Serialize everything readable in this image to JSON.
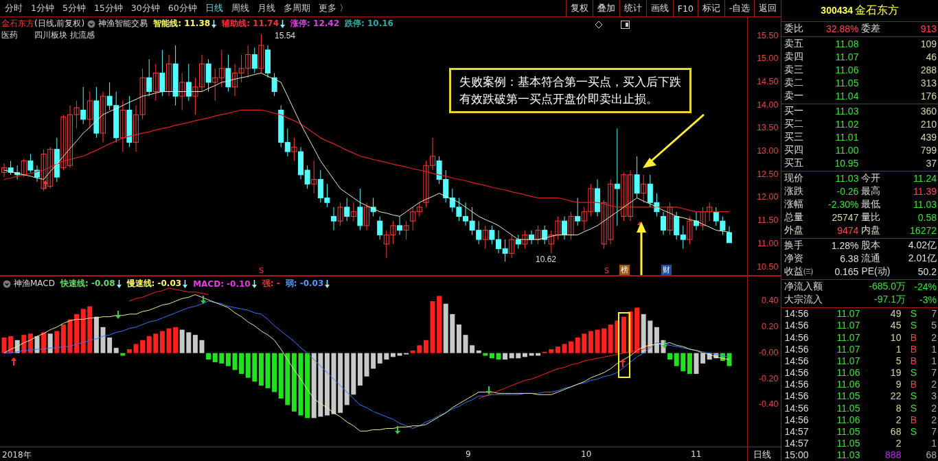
{
  "periods": [
    {
      "label": "分时",
      "selected": false
    },
    {
      "label": "1分钟",
      "selected": false
    },
    {
      "label": "5分钟",
      "selected": false
    },
    {
      "label": "15分钟",
      "selected": false
    },
    {
      "label": "30分钟",
      "selected": false
    },
    {
      "label": "60分钟",
      "selected": false
    },
    {
      "label": "日线",
      "selected": true
    },
    {
      "label": "周线",
      "selected": false
    },
    {
      "label": "月线",
      "selected": false
    },
    {
      "label": "多周期",
      "selected": false
    },
    {
      "label": "更多 〉",
      "selected": false
    }
  ],
  "tools": [
    "复权",
    "叠加",
    "统计",
    "画线",
    "F10",
    "标记",
    "-自选",
    "返回"
  ],
  "chart_info": {
    "stock": "金石东方",
    "mode": "(日线,前复权)",
    "indicator": "神渔智能交易",
    "lines": [
      {
        "label": "智能线: 11.38",
        "color": "#ffff66",
        "arrow": true
      },
      {
        "label": "辅助线: 11.74",
        "color": "#ff3030",
        "arrow": true
      },
      {
        "label": "涨停: 12.42",
        "color": "#e040e0",
        "arrow": false
      },
      {
        "label": "跌停: 10.16",
        "color": "#33aaaa",
        "arrow": false
      }
    ],
    "tags": [
      "医药",
      "四川板块",
      "抗流感"
    ]
  },
  "chart_data": {
    "type": "candlestick",
    "ylim": [
      10.33,
      15.91
    ],
    "ohlc": [
      [
        12.55,
        12.75,
        12.45,
        12.65
      ],
      [
        12.65,
        12.8,
        12.5,
        12.55
      ],
      [
        12.55,
        12.7,
        12.4,
        12.5
      ],
      [
        12.5,
        12.85,
        12.45,
        12.8
      ],
      [
        12.8,
        12.95,
        12.55,
        12.6
      ],
      [
        12.6,
        12.7,
        12.35,
        12.45
      ],
      [
        12.2,
        13.05,
        12.15,
        12.95
      ],
      [
        12.25,
        13.1,
        12.2,
        13.05
      ],
      [
        13.05,
        13.3,
        12.35,
        12.45
      ],
      [
        12.65,
        13.8,
        12.6,
        13.75
      ],
      [
        12.7,
        14.0,
        12.65,
        13.8
      ],
      [
        13.8,
        14.1,
        13.5,
        13.95
      ],
      [
        13.9,
        14.4,
        13.6,
        13.7
      ],
      [
        13.7,
        14.3,
        13.5,
        14.1
      ],
      [
        14.1,
        14.4,
        13.3,
        13.4
      ],
      [
        13.4,
        14.3,
        13.2,
        14.2
      ],
      [
        14.2,
        14.5,
        13.9,
        14.0
      ],
      [
        14.0,
        14.3,
        13.2,
        13.3
      ],
      [
        13.3,
        14.1,
        13.0,
        13.9
      ],
      [
        13.9,
        14.2,
        13.1,
        13.2
      ],
      [
        13.2,
        14.0,
        13.0,
        13.8
      ],
      [
        13.8,
        14.8,
        13.7,
        14.6
      ],
      [
        14.6,
        15.0,
        14.2,
        14.3
      ],
      [
        14.3,
        14.9,
        14.1,
        14.7
      ],
      [
        14.7,
        15.2,
        14.2,
        14.3
      ],
      [
        14.3,
        15.1,
        14.2,
        14.9
      ],
      [
        14.9,
        15.3,
        14.0,
        14.2
      ],
      [
        14.2,
        14.7,
        13.9,
        14.5
      ],
      [
        14.5,
        14.9,
        14.1,
        14.2
      ],
      [
        14.2,
        14.6,
        13.8,
        14.4
      ],
      [
        14.4,
        15.1,
        14.3,
        14.9
      ],
      [
        14.9,
        15.0,
        14.3,
        14.5
      ],
      [
        14.5,
        14.8,
        14.1,
        14.6
      ],
      [
        14.6,
        15.2,
        14.4,
        14.8
      ],
      [
        14.8,
        15.1,
        14.3,
        14.4
      ],
      [
        14.4,
        14.9,
        14.2,
        14.7
      ],
      [
        14.7,
        15.1,
        14.5,
        14.8
      ],
      [
        14.8,
        15.3,
        14.6,
        15.1
      ],
      [
        15.1,
        15.25,
        14.7,
        14.8
      ],
      [
        14.8,
        15.54,
        14.7,
        15.3
      ],
      [
        15.2,
        15.3,
        14.6,
        14.7
      ],
      [
        14.6,
        14.7,
        14.2,
        14.3
      ],
      [
        13.9,
        14.0,
        13.1,
        13.2
      ],
      [
        13.2,
        13.5,
        12.9,
        13.0
      ],
      [
        13.0,
        13.3,
        12.8,
        13.1
      ],
      [
        13.0,
        13.1,
        12.4,
        12.5
      ],
      [
        12.6,
        12.7,
        12.2,
        12.3
      ],
      [
        12.3,
        12.8,
        12.1,
        12.4
      ],
      [
        12.4,
        12.6,
        11.9,
        12.0
      ],
      [
        12.0,
        12.3,
        11.8,
        11.9
      ],
      [
        11.6,
        11.8,
        11.3,
        11.5
      ],
      [
        11.5,
        11.9,
        11.4,
        11.8
      ],
      [
        11.8,
        12.0,
        11.5,
        11.6
      ],
      [
        11.6,
        11.9,
        11.5,
        11.7
      ],
      [
        11.8,
        12.2,
        11.3,
        11.4
      ],
      [
        11.4,
        11.9,
        11.3,
        11.8
      ],
      [
        11.8,
        12.0,
        11.6,
        11.7
      ],
      [
        11.5,
        11.6,
        11.1,
        11.2
      ],
      [
        11.0,
        11.3,
        10.7,
        11.2
      ],
      [
        11.2,
        11.5,
        11.0,
        11.4
      ],
      [
        11.4,
        11.6,
        11.2,
        11.3
      ],
      [
        11.3,
        11.5,
        11.1,
        11.4
      ],
      [
        11.5,
        11.8,
        11.3,
        11.7
      ],
      [
        11.7,
        11.9,
        11.6,
        11.8
      ],
      [
        11.9,
        12.8,
        11.8,
        12.7
      ],
      [
        12.7,
        13.3,
        12.6,
        12.9
      ],
      [
        12.8,
        12.9,
        12.3,
        12.4
      ],
      [
        12.4,
        12.6,
        11.9,
        12.0
      ],
      [
        12.0,
        12.2,
        11.7,
        11.8
      ],
      [
        11.8,
        12.0,
        11.5,
        11.6
      ],
      [
        11.6,
        11.9,
        11.4,
        11.5
      ],
      [
        11.5,
        11.8,
        11.2,
        11.3
      ],
      [
        11.3,
        11.5,
        11.0,
        11.1
      ],
      [
        11.1,
        11.4,
        10.9,
        11.3
      ],
      [
        11.3,
        11.4,
        11.0,
        11.1
      ],
      [
        11.1,
        11.3,
        10.8,
        10.9
      ],
      [
        10.9,
        11.1,
        10.62,
        10.8
      ],
      [
        10.8,
        11.2,
        10.7,
        11.1
      ],
      [
        11.1,
        11.2,
        10.9,
        11.0
      ],
      [
        11.0,
        11.3,
        10.9,
        11.2
      ],
      [
        11.2,
        11.3,
        11.0,
        11.1
      ],
      [
        11.1,
        11.4,
        11.0,
        11.3
      ],
      [
        11.3,
        11.4,
        11.0,
        11.1
      ],
      [
        11.0,
        11.3,
        10.8,
        11.2
      ],
      [
        11.2,
        11.6,
        11.1,
        11.5
      ],
      [
        11.5,
        11.6,
        11.1,
        11.2
      ],
      [
        11.2,
        11.7,
        11.1,
        11.6
      ],
      [
        11.6,
        12.0,
        11.4,
        11.5
      ],
      [
        11.5,
        11.8,
        11.3,
        11.7
      ],
      [
        11.7,
        12.3,
        11.6,
        12.2
      ],
      [
        12.2,
        12.4,
        11.6,
        11.7
      ],
      [
        11.0,
        11.95,
        10.9,
        11.9
      ],
      [
        11.1,
        12.4,
        11.0,
        12.3
      ],
      [
        12.3,
        13.5,
        11.4,
        12.2
      ],
      [
        11.6,
        12.55,
        11.5,
        12.5
      ],
      [
        11.6,
        12.6,
        11.5,
        12.5
      ],
      [
        12.5,
        12.9,
        12.0,
        12.1
      ],
      [
        12.1,
        12.5,
        11.9,
        12.3
      ],
      [
        12.3,
        12.5,
        11.8,
        11.9
      ],
      [
        11.9,
        12.1,
        11.6,
        11.7
      ],
      [
        11.6,
        11.7,
        11.2,
        11.3
      ],
      [
        11.3,
        11.9,
        11.2,
        11.8
      ],
      [
        11.6,
        11.7,
        11.1,
        11.2
      ],
      [
        11.2,
        11.4,
        10.9,
        11.1
      ],
      [
        11.1,
        11.6,
        11.0,
        11.5
      ],
      [
        11.5,
        11.7,
        11.3,
        11.4
      ],
      [
        11.4,
        11.8,
        11.3,
        11.7
      ],
      [
        11.7,
        11.9,
        11.5,
        11.8
      ],
      [
        11.7,
        11.8,
        11.4,
        11.5
      ],
      [
        11.5,
        11.6,
        11.2,
        11.3
      ],
      [
        11.25,
        11.39,
        11.03,
        11.03
      ]
    ],
    "yticks": [
      {
        "value": 15.5,
        "label": "15.50"
      },
      {
        "value": 15.0,
        "label": "15.00"
      },
      {
        "value": 14.5,
        "label": "14.50"
      },
      {
        "value": 14.0,
        "label": "14.00"
      },
      {
        "value": 13.5,
        "label": "13.50"
      },
      {
        "value": 13.0,
        "label": "13.00"
      },
      {
        "value": 12.5,
        "label": "12.50"
      },
      {
        "value": 12.0,
        "label": "12.00"
      },
      {
        "value": 11.5,
        "label": "11.50"
      },
      {
        "value": 11.0,
        "label": "11.00"
      },
      {
        "value": 10.5,
        "label": "10.50"
      }
    ],
    "series": [
      {
        "type": "line",
        "color": "#e02020",
        "values": [
          12.4,
          12.43,
          12.47,
          12.5,
          12.53,
          12.57,
          12.6,
          12.67,
          12.73,
          12.8,
          12.83,
          12.87,
          12.9,
          12.97,
          13.03,
          13.1,
          13.17,
          13.23,
          13.3,
          13.33,
          13.37,
          13.4,
          13.43,
          13.47,
          13.5,
          13.53,
          13.57,
          13.6,
          13.63,
          13.67,
          13.7,
          13.73,
          13.77,
          13.8,
          13.83,
          13.87,
          13.9,
          13.9,
          13.9,
          13.9,
          13.87,
          13.83,
          13.8,
          13.73,
          13.67,
          13.6,
          13.5,
          13.4,
          13.3,
          13.23,
          13.17,
          13.1,
          13.03,
          12.97,
          12.9,
          12.87,
          12.83,
          12.8,
          12.77,
          12.73,
          12.7,
          12.67,
          12.63,
          12.6,
          12.57,
          12.53,
          12.5,
          12.47,
          12.43,
          12.4,
          12.37,
          12.33,
          12.3,
          12.27,
          12.23,
          12.2,
          12.17,
          12.13,
          12.1,
          12.07,
          12.03,
          12.0,
          12.0,
          12.0,
          12.0,
          11.97,
          11.93,
          11.9,
          11.9,
          11.9,
          11.9,
          11.87,
          11.83,
          11.8,
          11.8,
          11.8,
          11.8,
          11.8,
          11.8,
          11.8,
          11.8,
          11.8,
          11.8,
          11.77,
          11.73,
          11.7,
          11.7,
          11.7,
          11.7,
          11.7,
          11.7
        ]
      },
      {
        "type": "line",
        "color": "#f0f0c0",
        "values": [
          12.6,
          12.57,
          12.53,
          12.5,
          12.47,
          12.43,
          12.4,
          12.57,
          12.73,
          12.9,
          13.07,
          13.23,
          13.4,
          13.53,
          13.67,
          13.8,
          13.87,
          13.93,
          14.0,
          14.07,
          14.13,
          14.2,
          14.23,
          14.27,
          14.3,
          14.3,
          14.3,
          14.3,
          14.3,
          14.3,
          14.3,
          14.37,
          14.43,
          14.5,
          14.53,
          14.57,
          14.6,
          14.63,
          14.67,
          14.7,
          14.63,
          14.57,
          14.5,
          14.2,
          13.9,
          13.6,
          13.33,
          13.07,
          12.8,
          12.6,
          12.4,
          12.2,
          12.1,
          12.0,
          11.9,
          11.83,
          11.77,
          11.7,
          11.67,
          11.63,
          11.6,
          11.7,
          11.8,
          11.9,
          11.97,
          12.03,
          12.1,
          12.03,
          11.97,
          11.9,
          11.8,
          11.7,
          11.6,
          11.53,
          11.47,
          11.4,
          11.3,
          11.2,
          11.1,
          11.1,
          11.1,
          11.1,
          11.13,
          11.17,
          11.2,
          11.2,
          11.2,
          11.2,
          11.27,
          11.33,
          11.4,
          11.5,
          11.6,
          11.7,
          11.8,
          11.9,
          12.0,
          11.93,
          11.87,
          11.8,
          11.73,
          11.67,
          11.6,
          11.57,
          11.53,
          11.5,
          11.43,
          11.37,
          11.3,
          11.28,
          11.26
        ]
      }
    ]
  },
  "price_labels": {
    "high": "15.54",
    "low": "10.62"
  },
  "markers": [
    {
      "kind": "sell",
      "text": "S"
    },
    {
      "kind": "sell",
      "text": "S"
    },
    {
      "kind": "rank",
      "text": "榜"
    },
    {
      "kind": "finance",
      "text": "财"
    }
  ],
  "annotation": {
    "lines": [
      "失败案例：基本符合第一买点，买入后下跌",
      "有效跌破第一买点开盘价即卖出止损。"
    ]
  },
  "macd_info": {
    "name": "神渔MACD",
    "lines": [
      {
        "label": "快速线: -0.08",
        "color": "#66dd66",
        "arrow": true
      },
      {
        "label": "慢速线: -0.03",
        "color": "#ffff66",
        "arrow": true
      },
      {
        "label": "MACD: -0.10",
        "color": "#e040e0",
        "arrow": true
      },
      {
        "label": "强: -",
        "color": "#ff3030",
        "arrow": false
      },
      {
        "label": "弱: -0.03",
        "color": "#5599ff",
        "arrow": true
      }
    ]
  },
  "macd_chart": {
    "chart_data": {
      "type": "bar",
      "ylim": [
        -0.72,
        0.59
      ],
      "yticks": [
        {
          "value": 0.4,
          "label": "0.40"
        },
        {
          "value": 0.2,
          "label": "0.20"
        },
        {
          "value": 0,
          "label": "-0.00"
        },
        {
          "value": -0.2,
          "label": "-0.20"
        },
        {
          "value": -0.4,
          "label": "-0.40"
        }
      ],
      "series": [
        {
          "type": "bar",
          "colors": [
            "#ff2020",
            "#ff2020",
            "#c8c8c8",
            "#ff2020",
            "#ff2020",
            "#c8c8c8",
            "#ff2020",
            "#c8c8c8",
            "#ff2020",
            "#ff2020",
            "#ff2020",
            "#ff2020",
            "#ff2020",
            "#ff2020",
            "#c8c8c8",
            "#c8c8c8",
            "#c8c8c8",
            "#c8c8c8",
            "#22e022",
            "#ff2020",
            "#ff2020",
            "#ff2020",
            "#ff2020",
            "#ff2020",
            "#ff2020",
            "#ff2020",
            "#ff2020",
            "#c8c8c8",
            "#c8c8c8",
            "#c8c8c8",
            "#c8c8c8",
            "#22e022",
            "#22e022",
            "#22e022",
            "#22e022",
            "#22e022",
            "#22e022",
            "#22e022",
            "#22e022",
            "#22e022",
            "#22e022",
            "#22e022",
            "#22e022",
            "#22e022",
            "#22e022",
            "#22e022",
            "#22e022",
            "#c8c8c8",
            "#c8c8c8",
            "#c8c8c8",
            "#c8c8c8",
            "#c8c8c8",
            "#c8c8c8",
            "#c8c8c8",
            "#c8c8c8",
            "#c8c8c8",
            "#c8c8c8",
            "#c8c8c8",
            "#c8c8c8",
            "#c8c8c8",
            "#c8c8c8",
            "#c8c8c8",
            "#ff2020",
            "#ff2020",
            "#ff2020",
            "#ff2020",
            "#ff2020",
            "#c8c8c8",
            "#c8c8c8",
            "#c8c8c8",
            "#c8c8c8",
            "#c8c8c8",
            "#c8c8c8",
            "#22e022",
            "#22e022",
            "#22e022",
            "#c8c8c8",
            "#c8c8c8",
            "#c8c8c8",
            "#c8c8c8",
            "#c8c8c8",
            "#c8c8c8",
            "#ff2020",
            "#ff2020",
            "#ff2020",
            "#ff2020",
            "#ff2020",
            "#ff2020",
            "#ff2020",
            "#ff2020",
            "#ff2020",
            "#ff2020",
            "#ff2020",
            "#ff2020",
            "#ff2020",
            "#ff2020",
            "#ff2020",
            "#c8c8c8",
            "#c8c8c8",
            "#c8c8c8",
            "#c8c8c8",
            "#22e022",
            "#22e022",
            "#22e022",
            "#22e022",
            "#c8c8c8",
            "#c8c8c8",
            "#c8c8c8",
            "#c8c8c8",
            "#22e022",
            "#22e022"
          ],
          "values": [
            0.12,
            0.13,
            0.1,
            0.14,
            0.15,
            0.13,
            0.16,
            0.15,
            0.17,
            0.22,
            0.26,
            0.3,
            0.34,
            0.36,
            0.28,
            0.2,
            0.12,
            0.04,
            -0.02,
            0.03,
            0.07,
            0.1,
            0.13,
            0.15,
            0.17,
            0.19,
            0.2,
            0.18,
            0.16,
            0.14,
            0.1,
            -0.05,
            -0.07,
            -0.08,
            -0.1,
            -0.13,
            -0.16,
            -0.19,
            -0.22,
            -0.25,
            -0.27,
            -0.3,
            -0.35,
            -0.4,
            -0.45,
            -0.48,
            -0.5,
            -0.5,
            -0.49,
            -0.48,
            -0.47,
            -0.46,
            -0.4,
            -0.32,
            -0.25,
            -0.18,
            -0.12,
            -0.08,
            -0.05,
            -0.03,
            -0.02,
            -0.01,
            0.02,
            0.06,
            0.1,
            0.4,
            0.44,
            0.38,
            0.3,
            0.22,
            0.14,
            0.06,
            0.02,
            -0.02,
            -0.04,
            -0.05,
            -0.05,
            -0.04,
            -0.04,
            -0.03,
            -0.02,
            -0.02,
            0.01,
            0.03,
            0.05,
            0.07,
            0.09,
            0.12,
            0.15,
            0.17,
            0.18,
            0.19,
            0.22,
            0.25,
            0.28,
            0.32,
            0.35,
            0.3,
            0.25,
            0.2,
            0.1,
            -0.05,
            -0.1,
            -0.14,
            -0.16,
            -0.16,
            -0.08,
            -0.05,
            -0.04,
            -0.06,
            -0.1
          ]
        },
        {
          "type": "line",
          "color": "#3377ff",
          "values": [
            0,
            0,
            0.01,
            0.02,
            0.02,
            0.03,
            0.03,
            0.04,
            0.04,
            0.05,
            0.05,
            0.07,
            0.08,
            0.1,
            0.11,
            0.13,
            0.14,
            0.16,
            0.17,
            0.19,
            0.2,
            0.22,
            0.24,
            0.25,
            0.27,
            0.29,
            0.31,
            0.33,
            0.35,
            0.36,
            0.38,
            0.4,
            0.39,
            0.38,
            0.36,
            0.35,
            0.34,
            0.33,
            0.31,
            0.3,
            0.26,
            0.21,
            0.17,
            0.13,
            0.09,
            0.04,
            0,
            -0.05,
            -0.1,
            -0.15,
            -0.2,
            -0.25,
            -0.3,
            -0.35,
            -0.4,
            -0.42,
            -0.45,
            -0.47,
            -0.49,
            -0.51,
            -0.54,
            -0.56,
            -0.58,
            -0.56,
            -0.53,
            -0.51,
            -0.48,
            -0.46,
            -0.43,
            -0.41,
            -0.38,
            -0.36,
            -0.33,
            -0.33,
            -0.32,
            -0.32,
            -0.32,
            -0.32,
            -0.32,
            -0.31,
            -0.31,
            -0.31,
            -0.3,
            -0.3,
            -0.29,
            -0.27,
            -0.26,
            -0.24,
            -0.23,
            -0.21,
            -0.2,
            -0.18,
            -0.17,
            -0.15,
            -0.11,
            -0.07,
            -0.03,
            0,
            0.04,
            0.08,
            0.07,
            0.06,
            0.05,
            0.04,
            0.03,
            0.02,
            0.01,
            0,
            -0.01,
            -0.02,
            -0.03
          ]
        },
        {
          "type": "line",
          "color": "#eeee99",
          "values": [
            0,
            0.03,
            0.05,
            0.08,
            0.1,
            0.13,
            0.15,
            0.18,
            0.2,
            0.23,
            0.25,
            0.26,
            0.26,
            0.27,
            0.27,
            0.28,
            0.28,
            0.29,
            0.29,
            0.3,
            0.3,
            0.32,
            0.33,
            0.35,
            0.37,
            0.38,
            0.4,
            0.42,
            0.43,
            0.45,
            0.43,
            0.41,
            0.39,
            0.37,
            0.35,
            0.31,
            0.28,
            0.24,
            0.21,
            0.17,
            0.14,
            0.1,
            0.03,
            -0.05,
            -0.13,
            -0.2,
            -0.28,
            -0.35,
            -0.39,
            -0.42,
            -0.46,
            -0.49,
            -0.53,
            -0.56,
            -0.6,
            -0.6,
            -0.59,
            -0.59,
            -0.58,
            -0.58,
            -0.57,
            -0.57,
            -0.56,
            -0.56,
            -0.55,
            -0.52,
            -0.49,
            -0.46,
            -0.42,
            -0.39,
            -0.36,
            -0.33,
            -0.3,
            -0.3,
            -0.3,
            -0.31,
            -0.31,
            -0.31,
            -0.31,
            -0.31,
            -0.31,
            -0.32,
            -0.32,
            -0.32,
            -0.3,
            -0.28,
            -0.26,
            -0.24,
            -0.22,
            -0.19,
            -0.17,
            -0.15,
            -0.12,
            -0.08,
            -0.05,
            -0.02,
            0.02,
            0.05,
            0.06,
            0.07,
            0.07,
            0.08,
            0.06,
            0.05,
            0.03,
            0.02,
            0,
            -0.01,
            -0.03,
            -0.04,
            -0.05
          ]
        },
        {
          "type": "line",
          "color": "#ff2020",
          "values": [
            null,
            null,
            null,
            null,
            null,
            null,
            null,
            null,
            null,
            null,
            null,
            null,
            null,
            null,
            null,
            null,
            null,
            null,
            null,
            0.4,
            0.42,
            0.43,
            0.45,
            0.47,
            0.48,
            0.5,
            0.49,
            0.48,
            0.47,
            0.47,
            0.46,
            0.45,
            null,
            null,
            null,
            null,
            null,
            null,
            null,
            null,
            null,
            null,
            null,
            null,
            null,
            null,
            null,
            null,
            null,
            null,
            null,
            null,
            null,
            null,
            null,
            null,
            null,
            null,
            null,
            null,
            null,
            null,
            null,
            null,
            null,
            null,
            null,
            null,
            null,
            null,
            null,
            null,
            -0.35,
            -0.33,
            -0.31,
            -0.29,
            -0.27,
            -0.25,
            -0.23,
            -0.21,
            -0.2,
            -0.18,
            -0.16,
            -0.14,
            -0.12,
            -0.11,
            -0.09,
            -0.08,
            -0.06,
            -0.05,
            -0.04,
            -0.03,
            -0.02,
            -0.01,
            0,
            0.01,
            0.02,
            0.03,
            0.05,
            null,
            null,
            null,
            null,
            null,
            null,
            null,
            null,
            null,
            null,
            null,
            null
          ]
        }
      ]
    }
  },
  "time_axis": [
    "2018年",
    "9",
    "10",
    "11"
  ],
  "period_label": "日线",
  "quote": {
    "code": "300434",
    "name": "金石东方",
    "ratio": {
      "left": {
        "label": "委比",
        "value": "32.88%",
        "color": "#ff4a4a"
      },
      "right": {
        "label": "委差",
        "value": "913",
        "color": "#ff4a4a"
      }
    },
    "asks": [
      {
        "label": "卖五",
        "price": "11.08",
        "volume": "109"
      },
      {
        "label": "卖四",
        "price": "11.07",
        "volume": "46"
      },
      {
        "label": "卖三",
        "price": "11.06",
        "volume": "288"
      },
      {
        "label": "卖二",
        "price": "11.05",
        "volume": "313"
      },
      {
        "label": "卖一",
        "price": "11.04",
        "volume": "176"
      }
    ],
    "bids": [
      {
        "label": "买一",
        "price": "11.03",
        "volume": "360"
      },
      {
        "label": "买二",
        "price": "11.02",
        "volume": "210"
      },
      {
        "label": "买三",
        "price": "11.01",
        "volume": "439"
      },
      {
        "label": "买四",
        "price": "11.00",
        "volume": "799"
      },
      {
        "label": "买五",
        "price": "10.95",
        "volume": "37"
      }
    ],
    "stats": [
      {
        "left": {
          "label": "现价",
          "value": "11.03",
          "color": "#40e040"
        },
        "right": {
          "label": "今开",
          "value": "11.24",
          "color": "#40e040"
        }
      },
      {
        "left": {
          "label": "涨跌",
          "value": "-0.26",
          "color": "#40e040"
        },
        "right": {
          "label": "最高",
          "value": "11.39",
          "color": "#ff4a4a"
        }
      },
      {
        "left": {
          "label": "涨幅",
          "value": "-2.30%",
          "color": "#40e040"
        },
        "right": {
          "label": "最低",
          "value": "11.03",
          "color": "#40e040"
        }
      },
      {
        "left": {
          "label": "总量",
          "value": "25747",
          "color": "#d8d8a8"
        },
        "right": {
          "label": "量比",
          "value": "0.58",
          "color": "#40e040"
        }
      },
      {
        "left": {
          "label": "外盘",
          "value": "9474",
          "color": "#ff4a4a"
        },
        "right": {
          "label": "内盘",
          "value": "16272",
          "color": "#40e040"
        }
      }
    ],
    "stats2": [
      {
        "left": {
          "label": "换手",
          "value": "1.28%"
        },
        "right": {
          "label": "股本",
          "value": "4.02亿"
        }
      },
      {
        "left": {
          "label": "净资",
          "value": "6.38"
        },
        "right": {
          "label": "流通",
          "value": "2.01亿"
        }
      },
      {
        "left": {
          "label": "收益㈢",
          "value": "0.165"
        },
        "right": {
          "label": "PE(动)",
          "value": "50.2"
        }
      }
    ],
    "flows": [
      {
        "label": "净流入额",
        "amount": "-685.0万",
        "percent": "-24%"
      },
      {
        "label": "大宗流入",
        "amount": "-97.1万",
        "percent": "-3%"
      }
    ],
    "ticks": [
      {
        "time": "14:56",
        "price": "11.07",
        "volume": "49",
        "side": "S",
        "count": "7"
      },
      {
        "time": "14:56",
        "price": "11.07",
        "volume": "45",
        "side": "S",
        "count": "5"
      },
      {
        "time": "14:56",
        "price": "11.07",
        "volume": "10",
        "side": "B",
        "count": "2"
      },
      {
        "time": "14:56",
        "price": "11.07",
        "volume": "1",
        "side": "B",
        "count": "1"
      },
      {
        "time": "14:56",
        "price": "11.07",
        "volume": "5",
        "side": "B",
        "count": "1"
      },
      {
        "time": "14:56",
        "price": "11.06",
        "volume": "19",
        "side": "S",
        "count": "7"
      },
      {
        "time": "14:56",
        "price": "11.06",
        "volume": "9",
        "side": "B",
        "count": "2"
      },
      {
        "time": "14:56",
        "price": "11.05",
        "volume": "22",
        "side": "S",
        "count": "3"
      },
      {
        "time": "14:56",
        "price": "11.05",
        "volume": "8",
        "side": "S",
        "count": "2"
      },
      {
        "time": "14:56",
        "price": "11.06",
        "volume": "2",
        "side": "B",
        "count": "2"
      },
      {
        "time": "14:57",
        "price": "11.05",
        "volume": "68",
        "side": "S",
        "count": "7"
      },
      {
        "time": "14:57",
        "price": "11.05",
        "volume": "2",
        "count": "1"
      },
      {
        "time": "15:00",
        "price": "11.03",
        "volume": "888",
        "count": "68",
        "kind": "close"
      }
    ]
  }
}
